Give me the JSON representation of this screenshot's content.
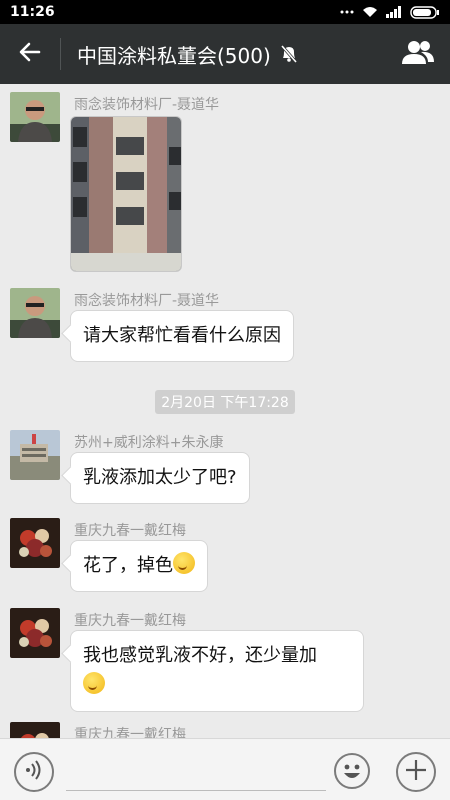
{
  "status_bar": {
    "time": "11:26"
  },
  "header": {
    "title": "中国涂料私董会(500)"
  },
  "messages": [
    {
      "sender": "雨念装饰材料厂-聂道华",
      "type": "image"
    },
    {
      "sender": "雨念装饰材料厂-聂道华",
      "text": "请大家帮忙看看什么原因"
    },
    {
      "sender": "苏州+威利涂料+朱永康",
      "text": "乳液添加太少了吧?"
    },
    {
      "sender": "重庆九春一戴红梅",
      "text": "花了，掉色"
    },
    {
      "sender": "重庆九春一戴红梅",
      "text": "我也感觉乳液不好，还少量加"
    },
    {
      "sender": "重庆九春一戴红梅"
    }
  ],
  "timestamp": "2月20日 下午17:28",
  "input": {
    "placeholder": ""
  },
  "colors": {
    "title_bar": "#2e3132",
    "chat_bg": "#ebebeb",
    "bubble": "#ffffff"
  }
}
